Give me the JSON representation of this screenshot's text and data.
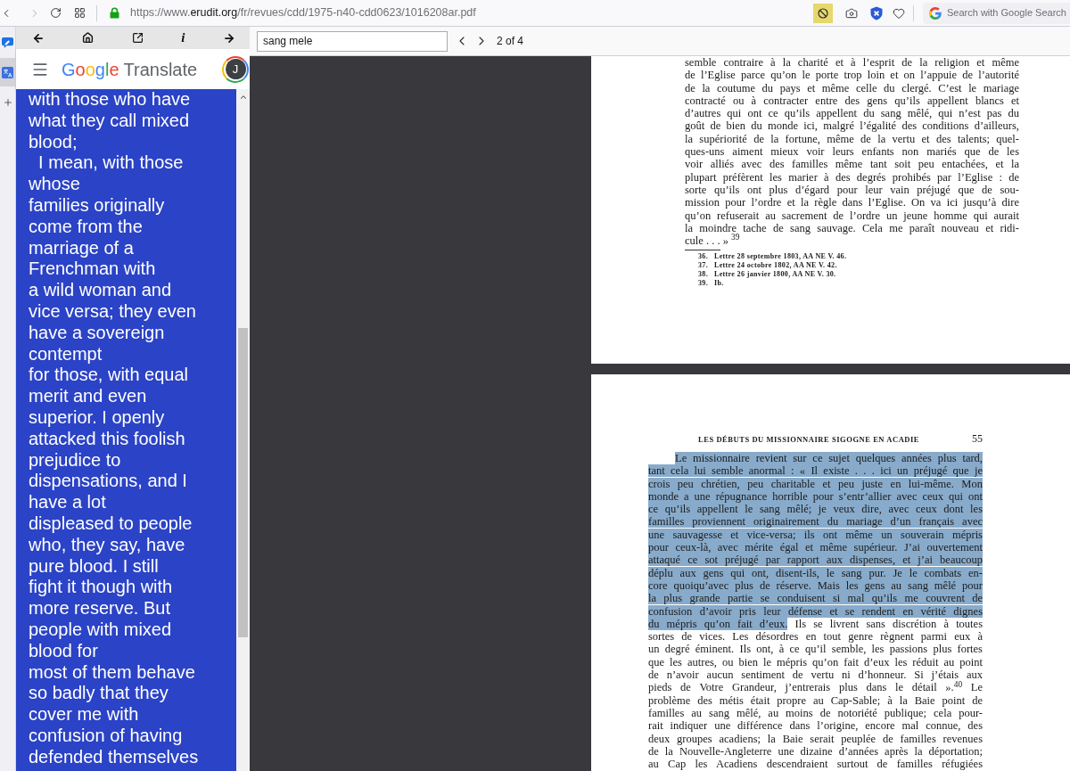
{
  "browser": {
    "back": {
      "disabled": false
    },
    "forward": {
      "disabled": true
    },
    "address": {
      "prefix": "https://www.",
      "domain": "erudit.org",
      "path": "/fr/revues/cdd/1975-n40-cdd0623/1016208ar.pdf"
    },
    "blocker": {
      "active": true
    },
    "search": {
      "placeholder": "Search with Google Search"
    }
  },
  "sidebar": {
    "items": [
      {
        "selected": false
      },
      {
        "selected": true
      },
      {
        "selected": false
      }
    ]
  },
  "translate_panel": {
    "toolbar": {
      "info": "i"
    },
    "app_bar": {
      "logo": "Google",
      "title": "Translate",
      "avatar": "J"
    },
    "output": {
      "lines": [
        "with those who have",
        "what they call mixed",
        "blood;",
        "  I mean, with those",
        "whose",
        "families originally",
        "come from the",
        "marriage of a",
        "Frenchman with",
        "a wild woman and",
        "vice versa; they even",
        "have a sovereign",
        "contempt",
        "for those, with equal",
        "merit and even",
        "superior. I openly",
        "attacked this foolish",
        "prejudice to",
        "dispensations, and I",
        "have a lot",
        "displeased to people",
        "who, they say, have",
        "pure blood. I still",
        "fight it though with",
        "more reserve. But",
        "people with mixed",
        "blood for",
        "most of them behave",
        "so badly that they",
        "cover me with",
        "confusion of having",
        "defended themselves"
      ]
    }
  },
  "pdf_viewer": {
    "find": {
      "value": "sang mele"
    },
    "match_count": "2 of 4",
    "pages": [
      {
        "lines": [
          {
            "text": "semble contraire à la charité et à l’esprit de la religion et même",
            "highlighted": false
          },
          {
            "text": "de l’Eglise parce qu’on le porte trop loin et on l’appuie de l’autorité",
            "highlighted": false
          },
          {
            "text": "de la coutume du pays et même celle du clergé. C’est le mariage",
            "highlighted": false
          },
          {
            "text": "contracté ou à contracter entre des gens qu’ils appellent blancs et",
            "highlighted": false
          },
          {
            "text": "d’autres qui ont ce qu’ils appellent du sang mêlé, qui n’est pas du",
            "highlighted": false
          },
          {
            "text": "goût de bien du monde ici, malgré l’égalité des conditions d’ailleurs,",
            "highlighted": false
          },
          {
            "text": "la supériorité de la fortune, même de la vertu et des talents; quel-",
            "highlighted": false
          },
          {
            "text": "ques-uns aiment mieux voir leurs enfants non mariés que de les",
            "highlighted": false
          },
          {
            "text": "voir alliés avec des familles même tant soit peu entachées, et la",
            "highlighted": false
          },
          {
            "text": "plupart préfèrent les marier à des degrés prohibés par l’Eglise : de",
            "highlighted": false
          },
          {
            "text": "sorte qu’ils ont plus d’égard pour leur vain préjugé que de sou-",
            "highlighted": false
          },
          {
            "text": "mission pour l’ordre et la règle dans l’Eglise. On va ici jusqu’à dire",
            "highlighted": false
          },
          {
            "text": "qu’on refuserait au sacrement de l’ordre un jeune homme qui aurait",
            "highlighted": false
          },
          {
            "text": "la moindre tache de sang sauvage. Cela me paraît nouveau et ridi-",
            "highlighted": false
          },
          {
            "text": "cule . . . » $^{39}$",
            "highlighted": false,
            "paragraph_end": true
          }
        ],
        "footnotes": [
          {
            "number": "36.",
            "text": "Lettre 28 septembre 1803, AA NE V. 46."
          },
          {
            "number": "37.",
            "text": "Lettre 24 octobre 1802, AA NE V. 42."
          },
          {
            "number": "38.",
            "text": "Lettre 26 janvier 1800, AA NE V. 30."
          },
          {
            "number": "39.",
            "text": "Ib."
          }
        ]
      },
      {
        "running_head": "LES DÉBUTS DU MISSIONNAIRE SIGOGNE EN ACADIE",
        "page_number": "55",
        "lines": [
          {
            "text": "Le missionnaire revient sur ce sujet quelques années plus tard,",
            "highlighted": true,
            "paragraph_start": true
          },
          {
            "text": "tant cela lui semble anormal : « Il existe . . . ici un préjugé que je",
            "highlighted": true
          },
          {
            "text": "crois peu chrétien, peu charitable et peu juste en lui-même. Mon",
            "highlighted": true
          },
          {
            "text": "monde a une répugnance horrible pour s’entr’allier avec ceux qui ont",
            "highlighted": true
          },
          {
            "text": "ce qu’ils appellent le sang mêlé; je veux dire, avec ceux dont les",
            "highlighted": true
          },
          {
            "text": "familles proviennent originairement du mariage d’un français avec",
            "highlighted": true
          },
          {
            "text": "une sauvagesse et vice-versa; ils ont même un souverain mépris",
            "highlighted": true
          },
          {
            "text": "pour ceux-là, avec mérite égal et même supérieur. J’ai ouvertement",
            "highlighted": true
          },
          {
            "text": "attaqué ce sot préjugé par rapport aux dispenses, et j’ai beaucoup",
            "highlighted": true
          },
          {
            "text": "déplu aux gens qui ont, disent-ils, le sang pur. Je le combats en-",
            "highlighted": true
          },
          {
            "text": "core quoiqu’avec plus de réserve. Mais les gens au sang mêlé pour",
            "highlighted": true
          },
          {
            "text": "la plus grande partie se conduisent si mal qu’ils me couvrent de",
            "highlighted": true
          },
          {
            "text": "confusion d’avoir pris leur défense et se rendent en vérité dignes",
            "highlighted": true
          },
          {
            "text": "du mépris qu’on fait d’eux.",
            "highlighted": true,
            "rest": "Ils se livrent sans discrétion à toutes"
          },
          {
            "text": "sortes de vices. Les désordres en tout genre règnent parmi eux à",
            "highlighted": false
          },
          {
            "text": "un degré éminent. Ils ont, à ce qu’il semble, les passions plus fortes",
            "highlighted": false
          },
          {
            "text": "que les autres, ou bien le mépris qu’on fait d’eux les réduit au point",
            "highlighted": false
          },
          {
            "text": "de n’avoir aucun sentiment de vertu ni d’honneur. Si j’étais aux",
            "highlighted": false
          },
          {
            "text": "pieds de Votre Grandeur, j’entrerais plus dans le détail ».$^{40}$ Le",
            "highlighted": false
          },
          {
            "text": "problème des métis était propre au Cap-Sable; à la Baie point de",
            "highlighted": false
          },
          {
            "text": "familles au sang mêlé, au moins de notoriété publique; cela pour-",
            "highlighted": false
          },
          {
            "text": "rait indiquer une différence dans l’origine, encore mal connue, des",
            "highlighted": false
          },
          {
            "text": "deux groupes acadiens; la Baie serait peuplée de familles revenues",
            "highlighted": false
          },
          {
            "text": "de la Nouvelle-Angleterre une dizaine d’années après la déportation;",
            "highlighted": false
          },
          {
            "text": "au Cap les Acadiens descendraient surtout de familles réfugiées",
            "highlighted": false
          }
        ]
      }
    ]
  }
}
